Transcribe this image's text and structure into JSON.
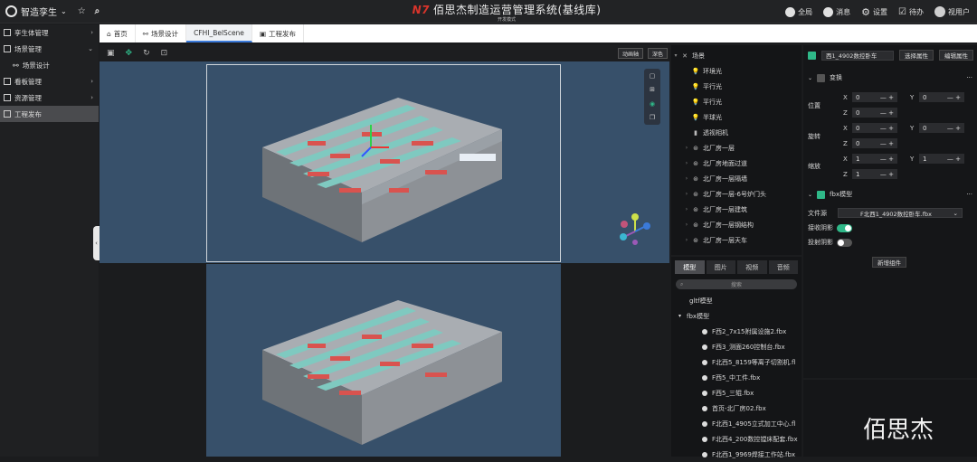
{
  "header": {
    "brand": "智造孪生",
    "title_logo": "N7",
    "title": "佰思杰制造运营管理系统(基线库)",
    "subtitle": "开发模式",
    "actions": [
      {
        "label": "全局",
        "icon": "globe-icon"
      },
      {
        "label": "消息",
        "icon": "message-icon"
      },
      {
        "label": "设置",
        "icon": "gear-icon"
      },
      {
        "label": "待办",
        "icon": "todo-icon"
      },
      {
        "label": "视用户",
        "icon": "user-avatar"
      }
    ]
  },
  "tabs": [
    "首页",
    "场景设计",
    "CFHI_BelScene",
    "工程发布"
  ],
  "sidebar": [
    {
      "label": "孪生体管理",
      "arrow": "›"
    },
    {
      "label": "场景管理",
      "arrow": "⌄"
    },
    {
      "label": "场景设计",
      "arrow": ""
    },
    {
      "label": "看板管理",
      "arrow": "›"
    },
    {
      "label": "资源管理",
      "arrow": "›"
    },
    {
      "label": "工程发布",
      "arrow": ""
    }
  ],
  "viewport": {
    "btn_animation": "动画轴",
    "btn_dark": "深色"
  },
  "scene_tree": [
    {
      "label": "场景",
      "caret": "▾"
    },
    {
      "label": "环境光",
      "caret": ""
    },
    {
      "label": "平行光",
      "caret": ""
    },
    {
      "label": "平行光",
      "caret": ""
    },
    {
      "label": "半球光",
      "caret": ""
    },
    {
      "label": "透视相机",
      "caret": ""
    },
    {
      "label": "北厂房一层",
      "caret": "›"
    },
    {
      "label": "北厂房地面过道",
      "caret": "›"
    },
    {
      "label": "北厂房一层隔墙",
      "caret": "›"
    },
    {
      "label": "北厂房一层-6号炉门头",
      "caret": "›"
    },
    {
      "label": "北厂房一层建筑",
      "caret": "›"
    },
    {
      "label": "北厂房一层钢结构",
      "caret": "›"
    },
    {
      "label": "北厂房一层天车",
      "caret": "›"
    }
  ],
  "assets": {
    "tabs": [
      "模型",
      "图片",
      "视频",
      "音频"
    ],
    "search_placeholder": "搜索",
    "groups": [
      "gltf模型",
      "fbx模型"
    ],
    "files": [
      "F西2_7x15附属设施2.fbx",
      "F西3_测面260控制台.fbx",
      "F北西5_8159等离子切割机.fl",
      "F西5_中工件.fbx",
      "F西5_三辊.fbx",
      "首页-北厂房02.fbx",
      "F北西1_4905立式加工中心.fl",
      "F北西4_200数控镗床配套.fbx",
      "F北西1_9969焊接工作站.fbx"
    ]
  },
  "properties": {
    "object_name": "西1_4902数控卧车",
    "btn_select": "选择属性",
    "btn_edit": "编辑属性",
    "transform_label": "变换",
    "position_label": "位置",
    "rotation_label": "旋转",
    "scale_label": "缩放",
    "position": {
      "x": "0",
      "y": "0",
      "z": "0"
    },
    "rotation": {
      "x": "0",
      "y": "0",
      "z": "0"
    },
    "scale": {
      "x": "1",
      "y": "1",
      "z": "1"
    },
    "fbx_label": "fbx模型",
    "file_label": "文件源",
    "file_value": "F北西1_4902数控卧车.fbx",
    "receive_shadow_label": "接收阴影",
    "cast_shadow_label": "投射阴影",
    "add_component": "新增组件",
    "more": "···"
  },
  "watermark": "佰思杰"
}
